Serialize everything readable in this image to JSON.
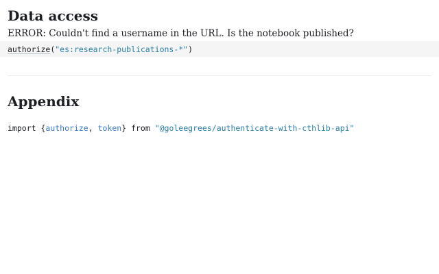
{
  "sections": {
    "data_access": {
      "title": "Data access",
      "error": "ERROR: Couldn't find a username in the URL. Is the notebook published?",
      "code": {
        "fn": "authorize",
        "open": "(",
        "arg": "\"es:research-publications-*\"",
        "close": ")"
      }
    },
    "appendix": {
      "title": "Appendix",
      "code": {
        "kw_import": "import",
        "brace_open": " {",
        "name1": "authorize",
        "comma": ", ",
        "name2": "token",
        "brace_close": "}",
        "kw_from": " from ",
        "source": "\"@goleegrees/authenticate-with-cthlib-api\""
      }
    }
  },
  "colors": {
    "string": "#2a7fa8",
    "variable": "#3c7cc7",
    "cell_background": "#f5f5f5"
  }
}
